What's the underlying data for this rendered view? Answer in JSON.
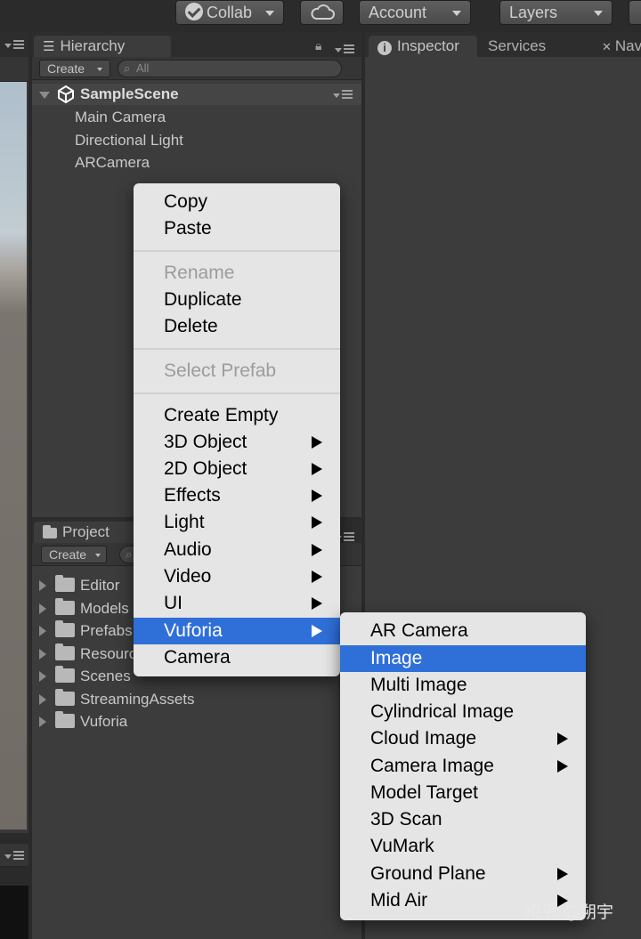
{
  "toolbar": {
    "collab_label": "Collab",
    "account_label": "Account",
    "layers_label": "Layers"
  },
  "hierarchy": {
    "tab_label": "Hierarchy",
    "create_label": "Create",
    "search_placeholder": "All",
    "scene_name": "SampleScene",
    "items": [
      "Main Camera",
      "Directional Light",
      "ARCamera"
    ]
  },
  "inspector": {
    "tabs": [
      "Inspector",
      "Services",
      "Nav"
    ]
  },
  "project": {
    "tab_label": "Project",
    "create_label": "Create",
    "folders": [
      "Editor",
      "Models",
      "Prefabs",
      "Resources",
      "Scenes",
      "StreamingAssets",
      "Vuforia"
    ]
  },
  "context_menu": {
    "groups": [
      [
        "Copy",
        "Paste"
      ],
      [
        "Rename",
        "Duplicate",
        "Delete"
      ],
      [
        "Select Prefab"
      ],
      [
        "Create Empty",
        "3D Object",
        "2D Object",
        "Effects",
        "Light",
        "Audio",
        "Video",
        "UI",
        "Vuforia",
        "Camera"
      ]
    ],
    "disabled": [
      "Rename",
      "Select Prefab"
    ],
    "submenus": [
      "3D Object",
      "2D Object",
      "Effects",
      "Light",
      "Audio",
      "Video",
      "UI",
      "Vuforia"
    ],
    "highlighted": "Vuforia"
  },
  "vuforia_submenu": {
    "items": [
      "AR Camera",
      "Image",
      "Multi Image",
      "Cylindrical Image",
      "Cloud Image",
      "Camera Image",
      "Model Target",
      "3D Scan",
      "VuMark",
      "Ground Plane",
      "Mid Air"
    ],
    "submenus": [
      "Cloud Image",
      "Camera Image",
      "Ground Plane",
      "Mid Air"
    ],
    "highlighted": "Image"
  },
  "watermark": "知乎 @朔宇",
  "colors": {
    "highlight": "#2f6fd8",
    "menu_bg": "#e5e5e5",
    "panel_bg": "#3c3c3c"
  }
}
